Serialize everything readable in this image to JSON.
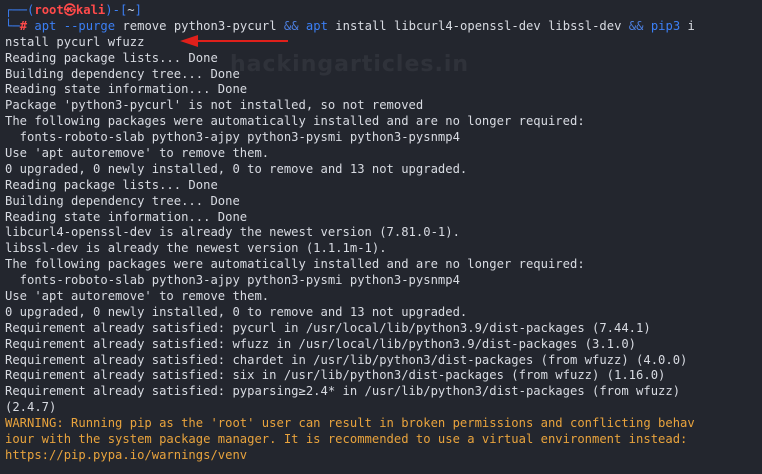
{
  "prompt": {
    "frame_top": "┌──(",
    "user": "root",
    "at_icon": "㉿",
    "host": "kali",
    "mid": ")-[",
    "cwd": "~",
    "end": "]",
    "frame_bottom": "└─",
    "hash": "#"
  },
  "command": {
    "part1": "apt",
    "part2": "--purge",
    "part3": "remove python3-pycurl",
    "op1": "&&",
    "part4": "apt",
    "part5": "install libcurl4-openssl-dev libssl-dev",
    "op2": "&&",
    "part6": "pip3",
    "part6_tail": "i",
    "wrap": "nstall pycurl wfuzz"
  },
  "watermark": "hackingarticles.in",
  "annotation": {
    "color": "#e0201b",
    "icon": "red-arrow-icon"
  },
  "output": [
    "Reading package lists... Done",
    "Building dependency tree... Done",
    "Reading state information... Done",
    "Package 'python3-pycurl' is not installed, so not removed",
    "The following packages were automatically installed and are no longer required:",
    "  fonts-roboto-slab python3-ajpy python3-pysmi python3-pysnmp4",
    "Use 'apt autoremove' to remove them.",
    "0 upgraded, 0 newly installed, 0 to remove and 13 not upgraded.",
    "Reading package lists... Done",
    "Building dependency tree... Done",
    "Reading state information... Done",
    "libcurl4-openssl-dev is already the newest version (7.81.0-1).",
    "libssl-dev is already the newest version (1.1.1m-1).",
    "The following packages were automatically installed and are no longer required:",
    "  fonts-roboto-slab python3-ajpy python3-pysmi python3-pysnmp4",
    "Use 'apt autoremove' to remove them.",
    "0 upgraded, 0 newly installed, 0 to remove and 13 not upgraded.",
    "Requirement already satisfied: pycurl in /usr/local/lib/python3.9/dist-packages (7.44.1)",
    "Requirement already satisfied: wfuzz in /usr/local/lib/python3.9/dist-packages (3.1.0)",
    "Requirement already satisfied: chardet in /usr/lib/python3/dist-packages (from wfuzz) (4.0.0)",
    "Requirement already satisfied: six in /usr/lib/python3/dist-packages (from wfuzz) (1.16.0)",
    "Requirement already satisfied: pyparsing≥2.4* in /usr/lib/python3/dist-packages (from wfuzz)",
    "(2.4.7)"
  ],
  "warning": [
    "WARNING: Running pip as the 'root' user can result in broken permissions and conflicting behav",
    "iour with the system package manager. It is recommended to use a virtual environment instead:",
    "https://pip.pypa.io/warnings/venv"
  ],
  "colors": {
    "background": "#23262e",
    "prompt_frame": "#3b7ff5",
    "prompt_user": "#ff4a4a",
    "warning": "#e8a33d"
  }
}
